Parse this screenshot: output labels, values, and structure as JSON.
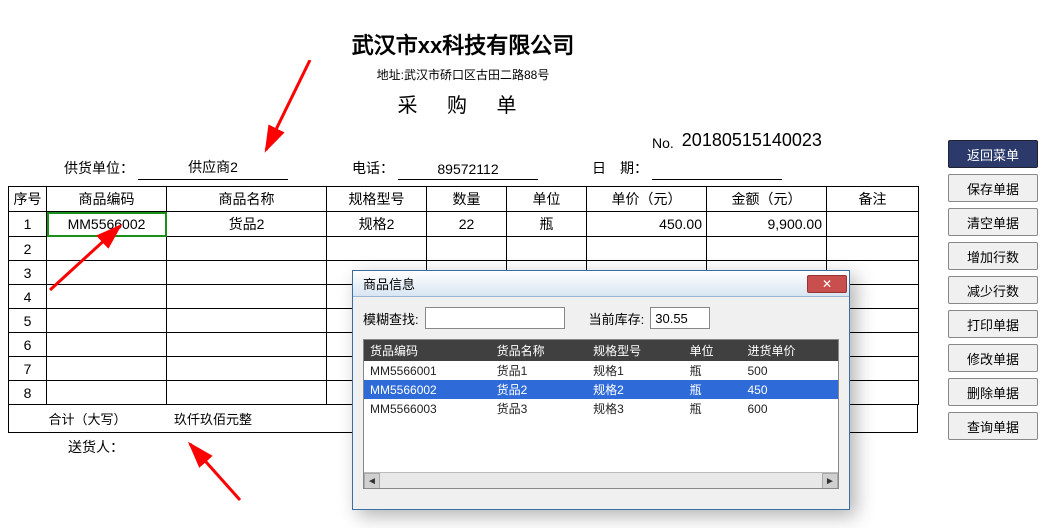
{
  "title": "武汉市xx科技有限公司",
  "address_label": "地址:武汉市硚口区古田二路88号",
  "doc_title": "采 购 单",
  "header": {
    "supplier_label": "供货单位：",
    "supplier": "供应商2",
    "phone_label": "电话：",
    "phone": "89572112",
    "no_label": "No.",
    "no": "20180515140023",
    "date_label": "日　期："
  },
  "columns": {
    "idx": "序号",
    "code": "商品编码",
    "name": "商品名称",
    "spec": "规格型号",
    "qty": "数量",
    "unit": "单位",
    "price": "单价（元）",
    "amount": "金额（元）",
    "remark": "备注"
  },
  "rows": [
    {
      "idx": "1",
      "code": "MM5566002",
      "name": "货品2",
      "spec": "规格2",
      "qty": "22",
      "unit": "瓶",
      "price": "450.00",
      "amount": "9,900.00",
      "remark": ""
    },
    {
      "idx": "2",
      "code": "",
      "name": "",
      "spec": "",
      "qty": "",
      "unit": "",
      "price": "",
      "amount": "",
      "remark": ""
    },
    {
      "idx": "3",
      "code": "",
      "name": "",
      "spec": "",
      "qty": "",
      "unit": "",
      "price": "",
      "amount": "",
      "remark": ""
    },
    {
      "idx": "4",
      "code": "",
      "name": "",
      "spec": "",
      "qty": "",
      "unit": "",
      "price": "",
      "amount": "",
      "remark": ""
    },
    {
      "idx": "5",
      "code": "",
      "name": "",
      "spec": "",
      "qty": "",
      "unit": "",
      "price": "",
      "amount": "",
      "remark": ""
    },
    {
      "idx": "6",
      "code": "",
      "name": "",
      "spec": "",
      "qty": "",
      "unit": "",
      "price": "",
      "amount": "",
      "remark": ""
    },
    {
      "idx": "7",
      "code": "",
      "name": "",
      "spec": "",
      "qty": "",
      "unit": "",
      "price": "",
      "amount": "",
      "remark": ""
    },
    {
      "idx": "8",
      "code": "",
      "name": "",
      "spec": "",
      "qty": "",
      "unit": "",
      "price": "",
      "amount": "",
      "remark": ""
    }
  ],
  "total_label": "合计（大写）",
  "total_cn": "玖仟玖佰元整",
  "sender_label": "送货人：",
  "buttons": {
    "b0": "返回菜单",
    "b1": "保存单据",
    "b2": "清空单据",
    "b3": "增加行数",
    "b4": "减少行数",
    "b5": "打印单据",
    "b6": "修改单据",
    "b7": "删除单据",
    "b8": "查询单据"
  },
  "dialog": {
    "title": "商品信息",
    "fuzzy_label": "模糊查找:",
    "fuzzy_value": "",
    "stock_label": "当前库存:",
    "stock_value": "30.55",
    "cols": {
      "code": "货品编码",
      "name": "货品名称",
      "spec": "规格型号",
      "unit": "单位",
      "price": "进货单价"
    },
    "items": [
      {
        "code": "MM5566001",
        "name": "货品1",
        "spec": "规格1",
        "unit": "瓶",
        "price": "500"
      },
      {
        "code": "MM5566002",
        "name": "货品2",
        "spec": "规格2",
        "unit": "瓶",
        "price": "450"
      },
      {
        "code": "MM5566003",
        "name": "货品3",
        "spec": "规格3",
        "unit": "瓶",
        "price": "600"
      }
    ],
    "selected": 1
  }
}
